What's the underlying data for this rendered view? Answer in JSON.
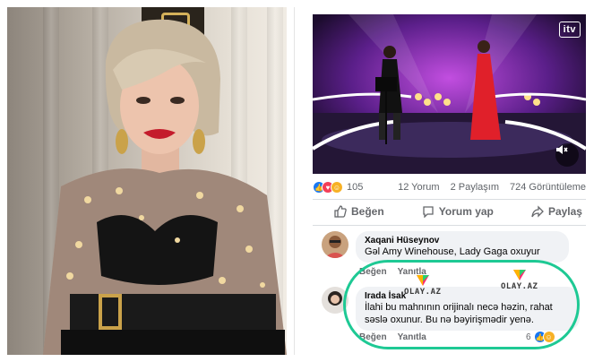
{
  "video": {
    "channel_logo": "itv"
  },
  "post_stats": {
    "reaction_icons": [
      "like-icon",
      "love-icon",
      "haha-icon"
    ],
    "reaction_count": "105",
    "comments": "12 Yorum",
    "shares": "2 Paylaşım",
    "views": "724 Görüntüleme"
  },
  "actions": {
    "like": "Beğen",
    "comment": "Yorum yap",
    "share": "Paylaş"
  },
  "comments": [
    {
      "author": "Xaqani Hüseynov",
      "text": "Gəl Amy Winehouse, Lady Gaga oxuyur",
      "like_link": "Beğen",
      "reply_link": "Yanıtla"
    },
    {
      "author": "Irada İsak",
      "text": "İlahi bu mahnının orijinalı necə həzin, rahat səslə oxunur. Bu nə bəyirişmədir yenə.",
      "like_link": "Beğen",
      "reply_link": "Yanıtla",
      "reaction_count": "6"
    }
  ],
  "watermark": {
    "text": "OLAY.AZ"
  },
  "colors": {
    "highlight": "#1ec994",
    "facebook_blue": "#1877f2"
  }
}
